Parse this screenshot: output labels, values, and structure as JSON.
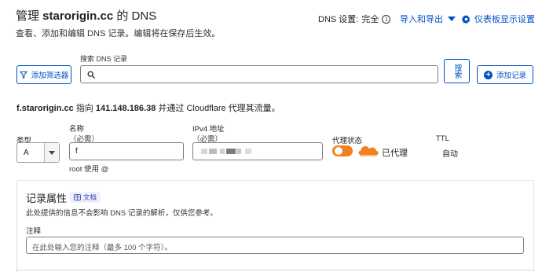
{
  "header": {
    "title_prefix": "管理 ",
    "domain": "starorigin.cc",
    "title_suffix": " 的 DNS",
    "subtitle": "查看、添加和编辑 DNS 记录。编辑将在保存后生效。",
    "dns_setting_label": "DNS 设置:",
    "dns_setting_value": "完全",
    "import_export_label": "导入和导出",
    "dashboard_settings_label": "仪表板显示设置"
  },
  "toolbar": {
    "filter_label": "添加筛选器",
    "search_label": "搜索 DNS 记录",
    "search_value": "",
    "search_button": "搜索",
    "add_record_label": "添加记录"
  },
  "record": {
    "summary_prefix": "f.starorigin.cc",
    "summary_mid": " 指向 ",
    "summary_ip": "141.148.186.38",
    "summary_suffix": " 并通过 Cloudflare 代理其流量。",
    "type_label": "类型",
    "type_value": "A",
    "name_label": "名称",
    "name_required": "（必需）",
    "name_value": "f",
    "name_hint": "root 使用 @",
    "ip_label": "IPv4 地址",
    "ip_required": "（必需）",
    "proxy_label": "代理状态",
    "proxy_value": "已代理",
    "proxy_enabled": true,
    "ttl_label": "TTL",
    "ttl_value": "自动"
  },
  "attributes": {
    "title": "记录属性",
    "doc_badge": "文档",
    "description": "此处提供的信息不会影响 DNS 记录的解析，仅供您参考。",
    "note_label": "注释",
    "note_placeholder": "在此处输入您的注释（最多 100 个字符）。"
  },
  "colors": {
    "link": "#0051c3",
    "proxy_orange": "#f38020"
  }
}
